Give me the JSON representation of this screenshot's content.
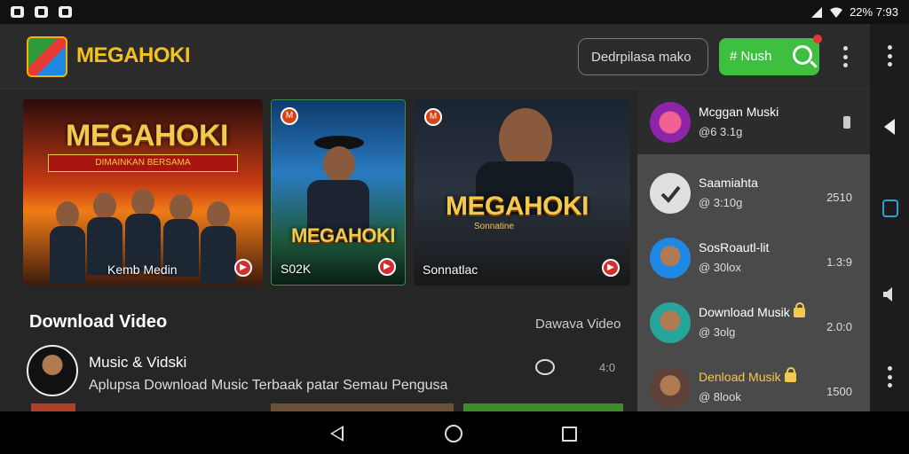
{
  "statusbar": {
    "left_icons": [
      "notification-icon",
      "notification-icon",
      "notification-icon"
    ],
    "right_text": "22% 7:93"
  },
  "header": {
    "logo_text": "MEGAHOKI",
    "search_placeholder": "Dedrpilasa mako",
    "search_button": "# Nush"
  },
  "cards": [
    {
      "title": "MEGAHOKI",
      "subtitle": "DIMAINKAN BERSAMA",
      "caption": "Kemb Medin"
    },
    {
      "title": "MEGAHOKI",
      "caption": "S02K"
    },
    {
      "title": "MEGAHOKI",
      "subtitle": "Sonnatine",
      "caption": "Sonnatlac"
    }
  ],
  "section": {
    "title": "Download Video",
    "link": "Dawava Video"
  },
  "list": [
    {
      "title": "Music & Vidski",
      "subtitle": "Aplupsa Download Music Terbaak patar Semau Pengusa",
      "count": "4:0"
    }
  ],
  "sidebar": {
    "items": [
      {
        "name": "Mcggan Muski",
        "meta": "@6 3.1g",
        "count": ""
      },
      {
        "name": "Saamiahta",
        "meta": "@ 3:10g",
        "count": "2510"
      },
      {
        "name": "SosRoautl-lit",
        "meta": "@ 30lox",
        "count": "1.3:9"
      },
      {
        "name": "Download Musik",
        "meta": "@ 3olg",
        "count": "2.0:0"
      },
      {
        "name": "Denload Musik",
        "meta": "@ 8look",
        "count": "1500"
      }
    ]
  },
  "colors": {
    "accent_green": "#3fbf3f",
    "logo_yellow": "#f5c21b",
    "badge_red": "#d32f2f",
    "panel_bg": "#4a4a4a"
  }
}
